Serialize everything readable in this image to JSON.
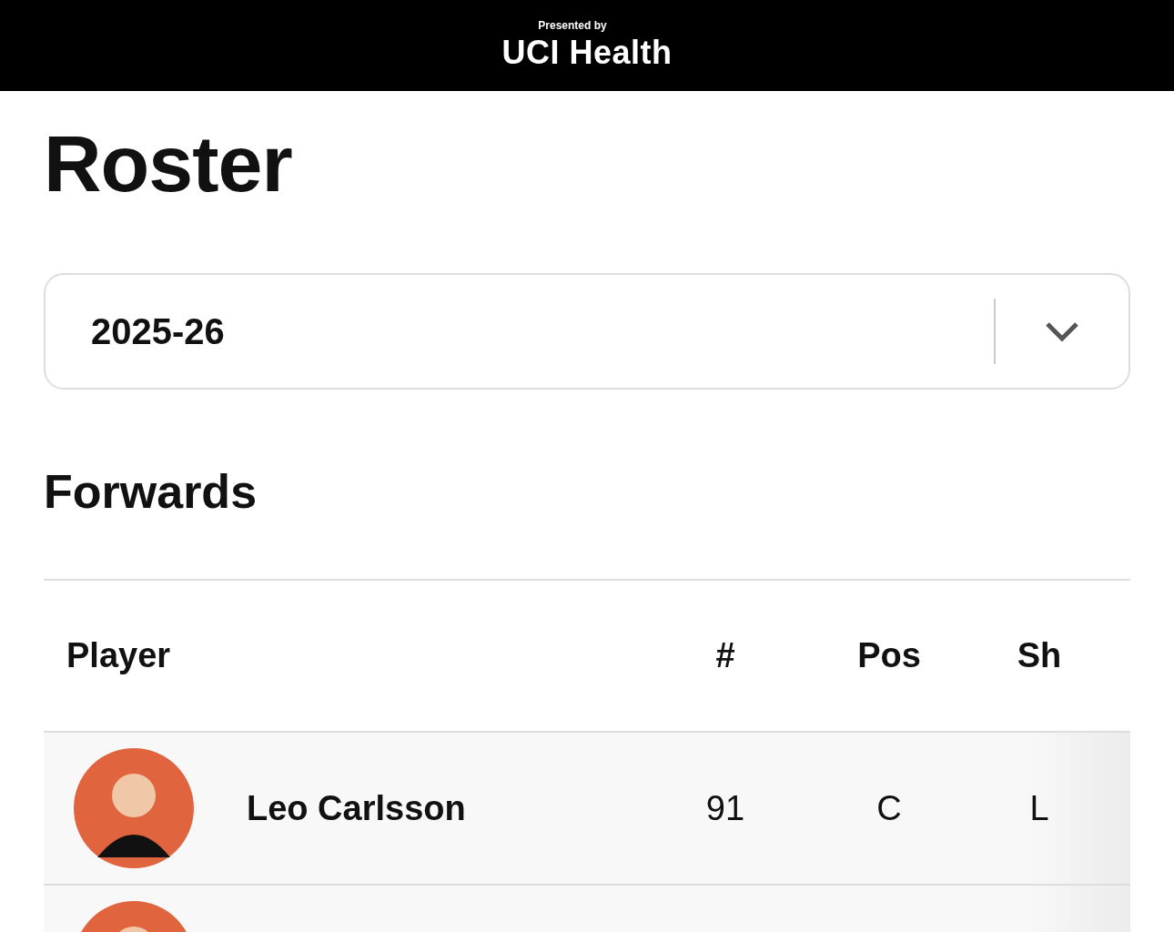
{
  "banner": {
    "presented_by": "Presented by",
    "sponsor": "UCI Health"
  },
  "title": "Roster",
  "season_select": {
    "value": "2025-26"
  },
  "section": {
    "heading": "Forwards",
    "columns": [
      "Player",
      "#",
      "Pos",
      "Sh"
    ],
    "rows": [
      {
        "kind": "player",
        "name": "Leo Carlsson",
        "number": "91",
        "position": "C",
        "shoots": "L"
      },
      {
        "kind": "player"
      }
    ]
  }
}
